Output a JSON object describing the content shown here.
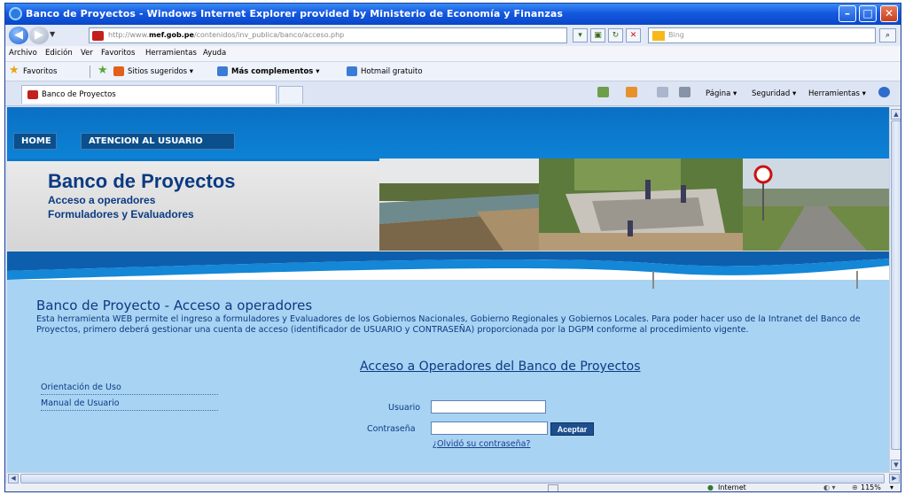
{
  "window": {
    "title": "Banco de Proyectos - Windows Internet Explorer provided by Ministerio de Economía y Finanzas"
  },
  "address": {
    "url_prefix": "http://www.",
    "url_domain": "mef.gob.pe",
    "url_path": "/contenidos/inv_publica/banco/acceso.php",
    "search_placeholder": "Bing"
  },
  "menu": [
    "Archivo",
    "Edición",
    "Ver",
    "Favoritos",
    "Herramientas",
    "Ayuda"
  ],
  "favorites": {
    "label": "Favoritos",
    "items": [
      "Sitios sugeridos ▾",
      "Más complementos ▾",
      "Hotmail gratuito"
    ]
  },
  "tab": {
    "label": "Banco de Proyectos"
  },
  "commands": [
    "Página ▾",
    "Seguridad ▾",
    "Herramientas ▾"
  ],
  "page": {
    "nav": [
      "HOME",
      "ATENCION AL USUARIO"
    ],
    "header_title": "Banco de Proyectos",
    "header_sub1": "Acceso a operadores",
    "header_sub2": "Formuladores y Evaluadores",
    "heading": "Banco de Proyecto - Acceso a operadores",
    "description": "Esta herramienta WEB permite el ingreso a formuladores y Evaluadores de los Gobiernos Nacionales, Gobierno Regionales y Gobiernos Locales. Para poder hacer uso de la Intranet del Banco de Proyectos, primero deberá gestionar una cuenta de acceso (identificador de USUARIO y CONTRASEÑA) proporcionada por la DGPM conforme al procedimiento vigente.",
    "login_title": "Acceso a Operadores del Banco de Proyectos",
    "side_links": [
      "Orientación de Uso",
      "Manual de Usuario"
    ],
    "user_label": "Usuario",
    "user_value": "",
    "password_label": "Contraseña",
    "password_value": "",
    "accept_label": "Aceptar",
    "forgot_label": "¿Olvidó su contraseña?"
  },
  "status": {
    "zone": "Internet",
    "zoom": "115%"
  }
}
